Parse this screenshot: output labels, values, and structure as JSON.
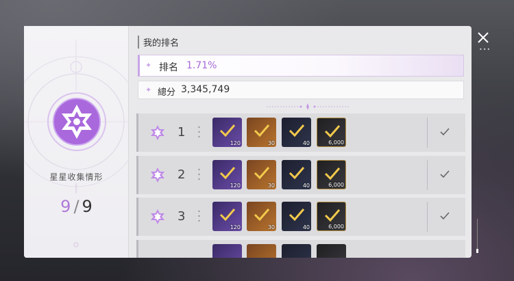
{
  "panel": {
    "collection_label": "星星收集情形",
    "collected": "9",
    "separator": "/",
    "total": "9"
  },
  "ranking": {
    "section_title": "我的排名",
    "rank_label": "排名",
    "rank_value": "1.71%",
    "score_label": "總分",
    "score_value": "3,345,749"
  },
  "rewards": [
    {
      "rank": "1",
      "items": [
        {
          "icon": "purple-crystal-icon",
          "qty": "120"
        },
        {
          "icon": "orange-material-icon",
          "qty": "30"
        },
        {
          "icon": "blue-gem-icon",
          "qty": "40"
        },
        {
          "icon": "gold-coin-icon",
          "qty": "6,000"
        }
      ],
      "claimed": true
    },
    {
      "rank": "2",
      "items": [
        {
          "icon": "purple-crystal-icon",
          "qty": "120"
        },
        {
          "icon": "orange-material-icon",
          "qty": "30"
        },
        {
          "icon": "blue-gem-icon",
          "qty": "40"
        },
        {
          "icon": "gold-coin-icon",
          "qty": "6,000"
        }
      ],
      "claimed": true
    },
    {
      "rank": "3",
      "items": [
        {
          "icon": "purple-crystal-icon",
          "qty": "120"
        },
        {
          "icon": "orange-material-icon",
          "qty": "30"
        },
        {
          "icon": "blue-gem-icon",
          "qty": "40"
        },
        {
          "icon": "gold-coin-icon",
          "qty": "6,000"
        }
      ],
      "claimed": true
    }
  ],
  "colors": {
    "accent": "#b07ad6",
    "check": "#f2c94c"
  }
}
